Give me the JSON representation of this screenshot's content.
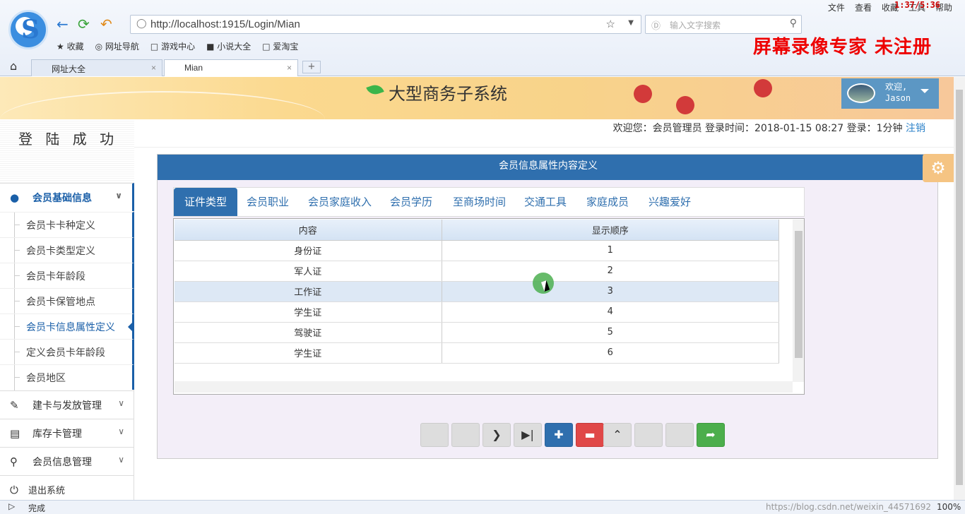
{
  "browser": {
    "menu": [
      "文件",
      "查看",
      "收藏",
      "工具",
      "帮助"
    ],
    "rec_time": "1:37/5:36",
    "url": "http://localhost:1915/Login/Mian",
    "search_placeholder": "输入文字搜索",
    "bookmarks": [
      "收藏",
      "网址导航",
      "游戏中心",
      "小说大全",
      "爱淘宝"
    ],
    "watermark": "屏幕录像专家  未注册",
    "tabs": [
      {
        "label": "网址大全"
      },
      {
        "label": "Mian"
      }
    ]
  },
  "header": {
    "title": "大型商务子系统",
    "welcome": "欢迎,",
    "username": "Jason"
  },
  "infobar": {
    "text": "欢迎您：会员管理员   登录时间：2018-01-15 08:27   登录：1分钟 ",
    "logout": "注销"
  },
  "sidebar": {
    "login_status": "登 陆 成 功",
    "sections": [
      {
        "label": "会员基础信息",
        "icon": "user-icon"
      },
      {
        "label": "建卡与发放管理",
        "icon": "edit-icon"
      },
      {
        "label": "库存卡管理",
        "icon": "save-icon"
      },
      {
        "label": "会员信息管理",
        "icon": "search-icon"
      }
    ],
    "sub_items": [
      "会员卡卡种定义",
      "会员卡类型定义",
      "会员卡年龄段",
      "会员卡保管地点",
      "会员卡信息属性定义",
      "定义会员卡年龄段",
      "会员地区"
    ],
    "exit": "退出系统"
  },
  "panel": {
    "title": "会员信息属性内容定义",
    "tabs": [
      "证件类型",
      "会员职业",
      "会员家庭收入",
      "会员学历",
      "至商场时间",
      "交通工具",
      "家庭成员",
      "兴趣爱好"
    ],
    "columns": [
      "内容",
      "显示顺序"
    ],
    "rows": [
      [
        "身份证",
        "1"
      ],
      [
        "军人证",
        "2"
      ],
      [
        "工作证",
        "3"
      ],
      [
        "学生证",
        "4"
      ],
      [
        "驾驶证",
        "5"
      ],
      [
        "学生证",
        "6"
      ]
    ],
    "selected_row": 2
  },
  "status": {
    "done": "完成",
    "url": "https://blog.csdn.net/weixin_44571692",
    "zoom": "100%"
  },
  "colors": {
    "primary": "#2f6fae",
    "danger": "#e04848",
    "success": "#4cae4c"
  }
}
